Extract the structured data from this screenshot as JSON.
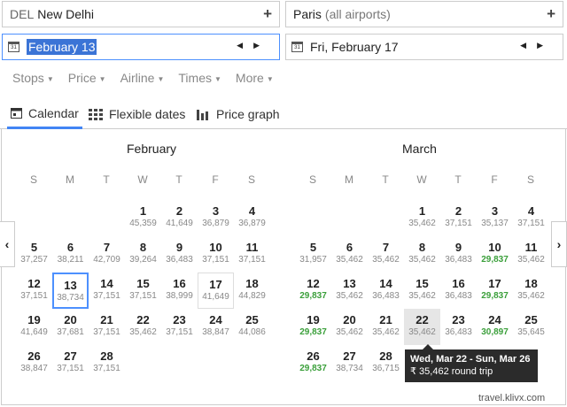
{
  "origin": {
    "code": "DEL",
    "city": "New Delhi"
  },
  "destination": {
    "city": "Paris",
    "note": "(all airports)"
  },
  "depart_date": "February 13",
  "return_date": "Fri, February 17",
  "filters": [
    "Stops",
    "Price",
    "Airline",
    "Times",
    "More"
  ],
  "tabs": {
    "calendar": "Calendar",
    "flexible": "Flexible dates",
    "graph": "Price graph"
  },
  "weekdays": [
    "S",
    "M",
    "T",
    "W",
    "T",
    "F",
    "S"
  ],
  "months": [
    {
      "name": "February",
      "weeks": [
        [
          null,
          null,
          null,
          {
            "d": "1",
            "p": "45,359"
          },
          {
            "d": "2",
            "p": "41,649"
          },
          {
            "d": "3",
            "p": "36,879"
          },
          {
            "d": "4",
            "p": "36,879"
          }
        ],
        [
          {
            "d": "5",
            "p": "37,257"
          },
          {
            "d": "6",
            "p": "38,211"
          },
          {
            "d": "7",
            "p": "42,709"
          },
          {
            "d": "8",
            "p": "39,264"
          },
          {
            "d": "9",
            "p": "36,483"
          },
          {
            "d": "10",
            "p": "37,151"
          },
          {
            "d": "11",
            "p": "37,151"
          }
        ],
        [
          {
            "d": "12",
            "p": "37,151"
          },
          {
            "d": "13",
            "p": "38,734",
            "state": "selected"
          },
          {
            "d": "14",
            "p": "37,151"
          },
          {
            "d": "15",
            "p": "37,151"
          },
          {
            "d": "16",
            "p": "38,999"
          },
          {
            "d": "17",
            "p": "41,649",
            "state": "outlined"
          },
          {
            "d": "18",
            "p": "44,829"
          }
        ],
        [
          {
            "d": "19",
            "p": "41,649"
          },
          {
            "d": "20",
            "p": "37,681"
          },
          {
            "d": "21",
            "p": "37,151"
          },
          {
            "d": "22",
            "p": "35,462"
          },
          {
            "d": "23",
            "p": "37,151"
          },
          {
            "d": "24",
            "p": "38,847"
          },
          {
            "d": "25",
            "p": "44,086"
          }
        ],
        [
          {
            "d": "26",
            "p": "38,847"
          },
          {
            "d": "27",
            "p": "37,151"
          },
          {
            "d": "28",
            "p": "37,151"
          },
          null,
          null,
          null,
          null
        ]
      ]
    },
    {
      "name": "March",
      "weeks": [
        [
          null,
          null,
          null,
          {
            "d": "1",
            "p": "35,462"
          },
          {
            "d": "2",
            "p": "37,151"
          },
          {
            "d": "3",
            "p": "35,137"
          },
          {
            "d": "4",
            "p": "37,151"
          }
        ],
        [
          {
            "d": "5",
            "p": "31,957"
          },
          {
            "d": "6",
            "p": "35,462"
          },
          {
            "d": "7",
            "p": "35,462"
          },
          {
            "d": "8",
            "p": "35,462"
          },
          {
            "d": "9",
            "p": "36,483"
          },
          {
            "d": "10",
            "p": "29,837",
            "low": true
          },
          {
            "d": "11",
            "p": "35,462"
          }
        ],
        [
          {
            "d": "12",
            "p": "29,837",
            "low": true
          },
          {
            "d": "13",
            "p": "35,462"
          },
          {
            "d": "14",
            "p": "36,483"
          },
          {
            "d": "15",
            "p": "35,462"
          },
          {
            "d": "16",
            "p": "36,483"
          },
          {
            "d": "17",
            "p": "29,837",
            "low": true
          },
          {
            "d": "18",
            "p": "35,462"
          }
        ],
        [
          {
            "d": "19",
            "p": "29,837",
            "low": true
          },
          {
            "d": "20",
            "p": "35,462"
          },
          {
            "d": "21",
            "p": "35,462"
          },
          {
            "d": "22",
            "p": "35,462",
            "state": "hovered"
          },
          {
            "d": "23",
            "p": "36,483"
          },
          {
            "d": "24",
            "p": "30,897",
            "low": true
          },
          {
            "d": "25",
            "p": "35,645"
          }
        ],
        [
          {
            "d": "26",
            "p": "29,837",
            "low": true
          },
          {
            "d": "27",
            "p": "38,734"
          },
          {
            "d": "28",
            "p": "36,715"
          },
          null,
          null,
          null,
          null
        ]
      ]
    }
  ],
  "tooltip": {
    "dates": "Wed, Mar 22 - Sun, Mar 26",
    "price": "₹ 35,462 round trip"
  },
  "watermark": "travel.klivx.com"
}
